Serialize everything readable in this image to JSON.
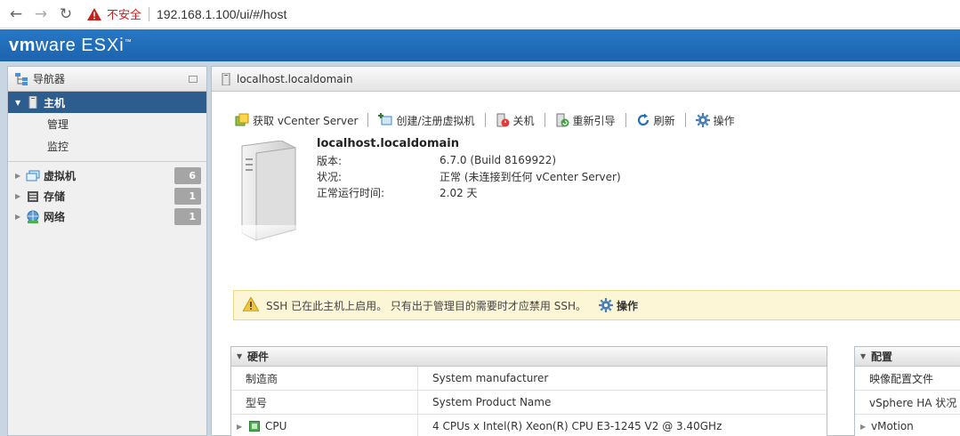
{
  "browser": {
    "insecure_label": "不安全",
    "url": "192.168.1.100/ui/#/host"
  },
  "header": {
    "logo_vm": "vm",
    "logo_ware": "ware",
    "logo_product": "ESXi",
    "logo_tm": "™"
  },
  "navigator": {
    "title": "导航器",
    "host_label": "主机",
    "host_children": [
      "管理",
      "监控"
    ],
    "items": [
      {
        "label": "虚拟机",
        "count": "6",
        "icon": "vm-icon"
      },
      {
        "label": "存储",
        "count": "1",
        "icon": "storage-icon"
      },
      {
        "label": "网络",
        "count": "1",
        "icon": "network-icon"
      }
    ]
  },
  "main": {
    "title": "localhost.localdomain",
    "toolbar": {
      "vcenter": "获取 vCenter Server",
      "create_vm": "创建/注册虚拟机",
      "shutdown": "关机",
      "reboot": "重新引导",
      "refresh": "刷新",
      "actions": "操作"
    },
    "host": {
      "name": "localhost.localdomain",
      "rows": [
        {
          "key": "版本:",
          "value": "6.7.0 (Build 8169922)"
        },
        {
          "key": "状况:",
          "value": "正常 (未连接到任何 vCenter Server)"
        },
        {
          "key": "正常运行时间:",
          "value": "2.02 天"
        }
      ]
    },
    "ssh_banner": {
      "message": "SSH 已在此主机上启用。 只有出于管理目的需要时才应禁用 SSH。",
      "action": "操作"
    },
    "hardware": {
      "title": "硬件",
      "rows": [
        {
          "key": "制造商",
          "value": "System manufacturer"
        },
        {
          "key": "型号",
          "value": "System Product Name"
        },
        {
          "key": "CPU",
          "value": "4 CPUs x Intel(R) Xeon(R) CPU E3-1245 V2 @ 3.40GHz"
        }
      ]
    },
    "config": {
      "title": "配置",
      "rows": [
        "映像配置文件",
        "vSphere HA 状况",
        "vMotion"
      ]
    }
  },
  "colors": {
    "header_blue": "#1c63ad",
    "nav_selected": "#2d5d8f",
    "badge_gray": "#a5a5a5",
    "warning_bg": "#fdf6d6"
  }
}
